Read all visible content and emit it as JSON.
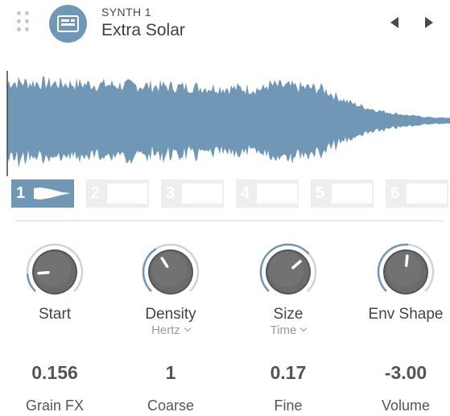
{
  "header": {
    "synth_label": "SYNTH 1",
    "preset_name": "Extra Solar",
    "icons": {
      "drag": "drag-handle-icon",
      "synth": "synth-module-icon",
      "prev": "triangle-left-icon",
      "next": "triangle-right-icon"
    }
  },
  "waveform": {
    "color": "#7097b6"
  },
  "slots": [
    {
      "label": "1",
      "active": true
    },
    {
      "label": "2",
      "active": false
    },
    {
      "label": "3",
      "active": false
    },
    {
      "label": "4",
      "active": false
    },
    {
      "label": "5",
      "active": false
    },
    {
      "label": "6",
      "active": false
    }
  ],
  "knobs": [
    {
      "label": "Start",
      "sublabel": "",
      "has_dropdown": false,
      "level": 0.15
    },
    {
      "label": "Density",
      "sublabel": "Hertz",
      "has_dropdown": true,
      "level": 0.38
    },
    {
      "label": "Size",
      "sublabel": "Time",
      "has_dropdown": true,
      "level": 0.68
    },
    {
      "label": "Env Shape",
      "sublabel": "",
      "has_dropdown": false,
      "level": 0.52
    }
  ],
  "params": [
    {
      "value": "0.156",
      "label": "Grain FX"
    },
    {
      "value": "1",
      "label": "Coarse"
    },
    {
      "value": "0.17",
      "label": "Fine"
    },
    {
      "value": "-3.00",
      "label": "Volume"
    }
  ],
  "colors": {
    "accent": "#7097b6",
    "knob_body": "#6b6b6b",
    "track": "#d2d2d2"
  }
}
